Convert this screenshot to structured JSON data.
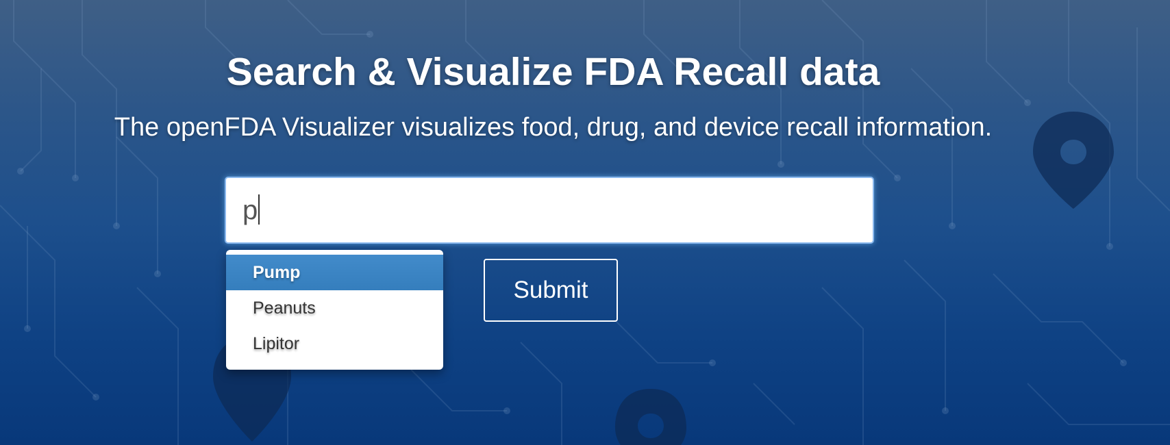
{
  "hero": {
    "title": "Search & Visualize FDA Recall data",
    "subtitle": "The openFDA Visualizer visualizes food, drug, and device recall information."
  },
  "search": {
    "value": "p",
    "suggestions": [
      "Pump",
      "Peanuts",
      "Lipitor"
    ],
    "active_suggestion": "Pump"
  },
  "submit": {
    "label": "Submit"
  },
  "icons": {
    "background": [
      "map-pin-icon",
      "map-pin-icon",
      "map-pin-icon"
    ]
  },
  "colors": {
    "background_top": "#3f5f86",
    "background_bottom": "#08387a",
    "active_suggestion": "#3a84c4",
    "focus_glow": "#66afe9"
  }
}
